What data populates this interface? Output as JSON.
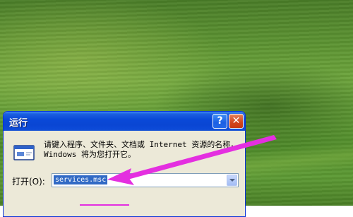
{
  "dialog": {
    "title": "运行",
    "help_label": "?",
    "close_label": "✕",
    "description": "请键入程序、文件夹、文档或 Internet 资源的名称，Windows 将为您打开它。",
    "open_label": "打开(O):",
    "command_value": "services.msc"
  },
  "icons": {
    "run": "run-program-icon",
    "help": "help-icon",
    "close": "close-icon",
    "dropdown": "chevron-down-icon"
  },
  "colors": {
    "title_bar": "#0a49d8",
    "dialog_face": "#ece9d8",
    "selection": "#316ac5",
    "annotation_arrow": "#e42fe0"
  }
}
